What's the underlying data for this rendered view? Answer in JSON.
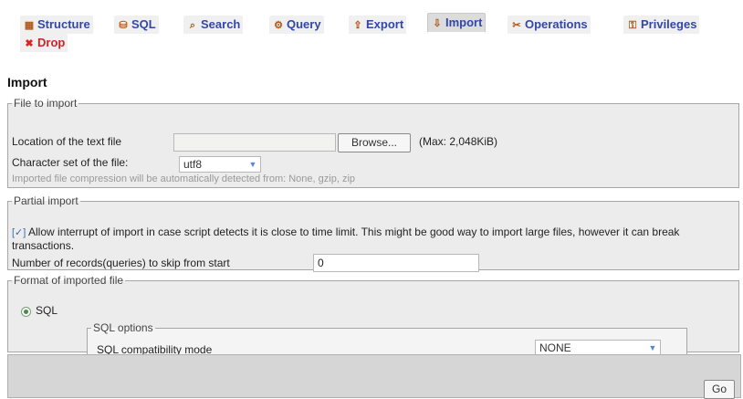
{
  "tabs": [
    {
      "label": "Structure",
      "icon": "structure-icon",
      "glyph": "▦"
    },
    {
      "label": "SQL",
      "icon": "sql-icon",
      "glyph": "⛁"
    },
    {
      "label": "Search",
      "icon": "search-icon",
      "glyph": "⌕"
    },
    {
      "label": "Query",
      "icon": "query-icon",
      "glyph": "⚙"
    },
    {
      "label": "Export",
      "icon": "export-icon",
      "glyph": "⇪"
    },
    {
      "label": "Import",
      "icon": "import-icon",
      "glyph": "⇩"
    },
    {
      "label": "Operations",
      "icon": "operations-icon",
      "glyph": "✂"
    },
    {
      "label": "Privileges",
      "icon": "privileges-icon",
      "glyph": "⚿"
    },
    {
      "label": "Drop",
      "icon": "drop-icon",
      "glyph": "✖"
    }
  ],
  "active_tab": "Import",
  "page_title": "Import",
  "file_to_import": {
    "legend": "File to import",
    "location_label": "Location of the text file",
    "browse_label": "Browse...",
    "max_label": "(Max: 2,048KiB)",
    "charset_label": "Character set of the file:",
    "charset_value": "utf8",
    "compression_note": "Imported file compression will be automatically detected from: None, gzip, zip"
  },
  "partial_import": {
    "legend": "Partial import",
    "interrupt_text": "Allow interrupt of import in case script detects it is close to time limit. This might be good way to import large files, however it can break transactions.",
    "checkbox_mark": "[✓]",
    "skip_label": "Number of records(queries) to skip from start",
    "skip_value": "0"
  },
  "format": {
    "legend": "Format of imported file",
    "option_label": "SQL",
    "sql_options_legend": "SQL options",
    "compat_label": "SQL compatibility mode",
    "compat_value": "NONE"
  },
  "footer": {
    "go_label": "Go"
  },
  "colors": {
    "tab_text": "#3347a8",
    "drop_text": "#c8252b",
    "panel_bg": "#ececec"
  }
}
